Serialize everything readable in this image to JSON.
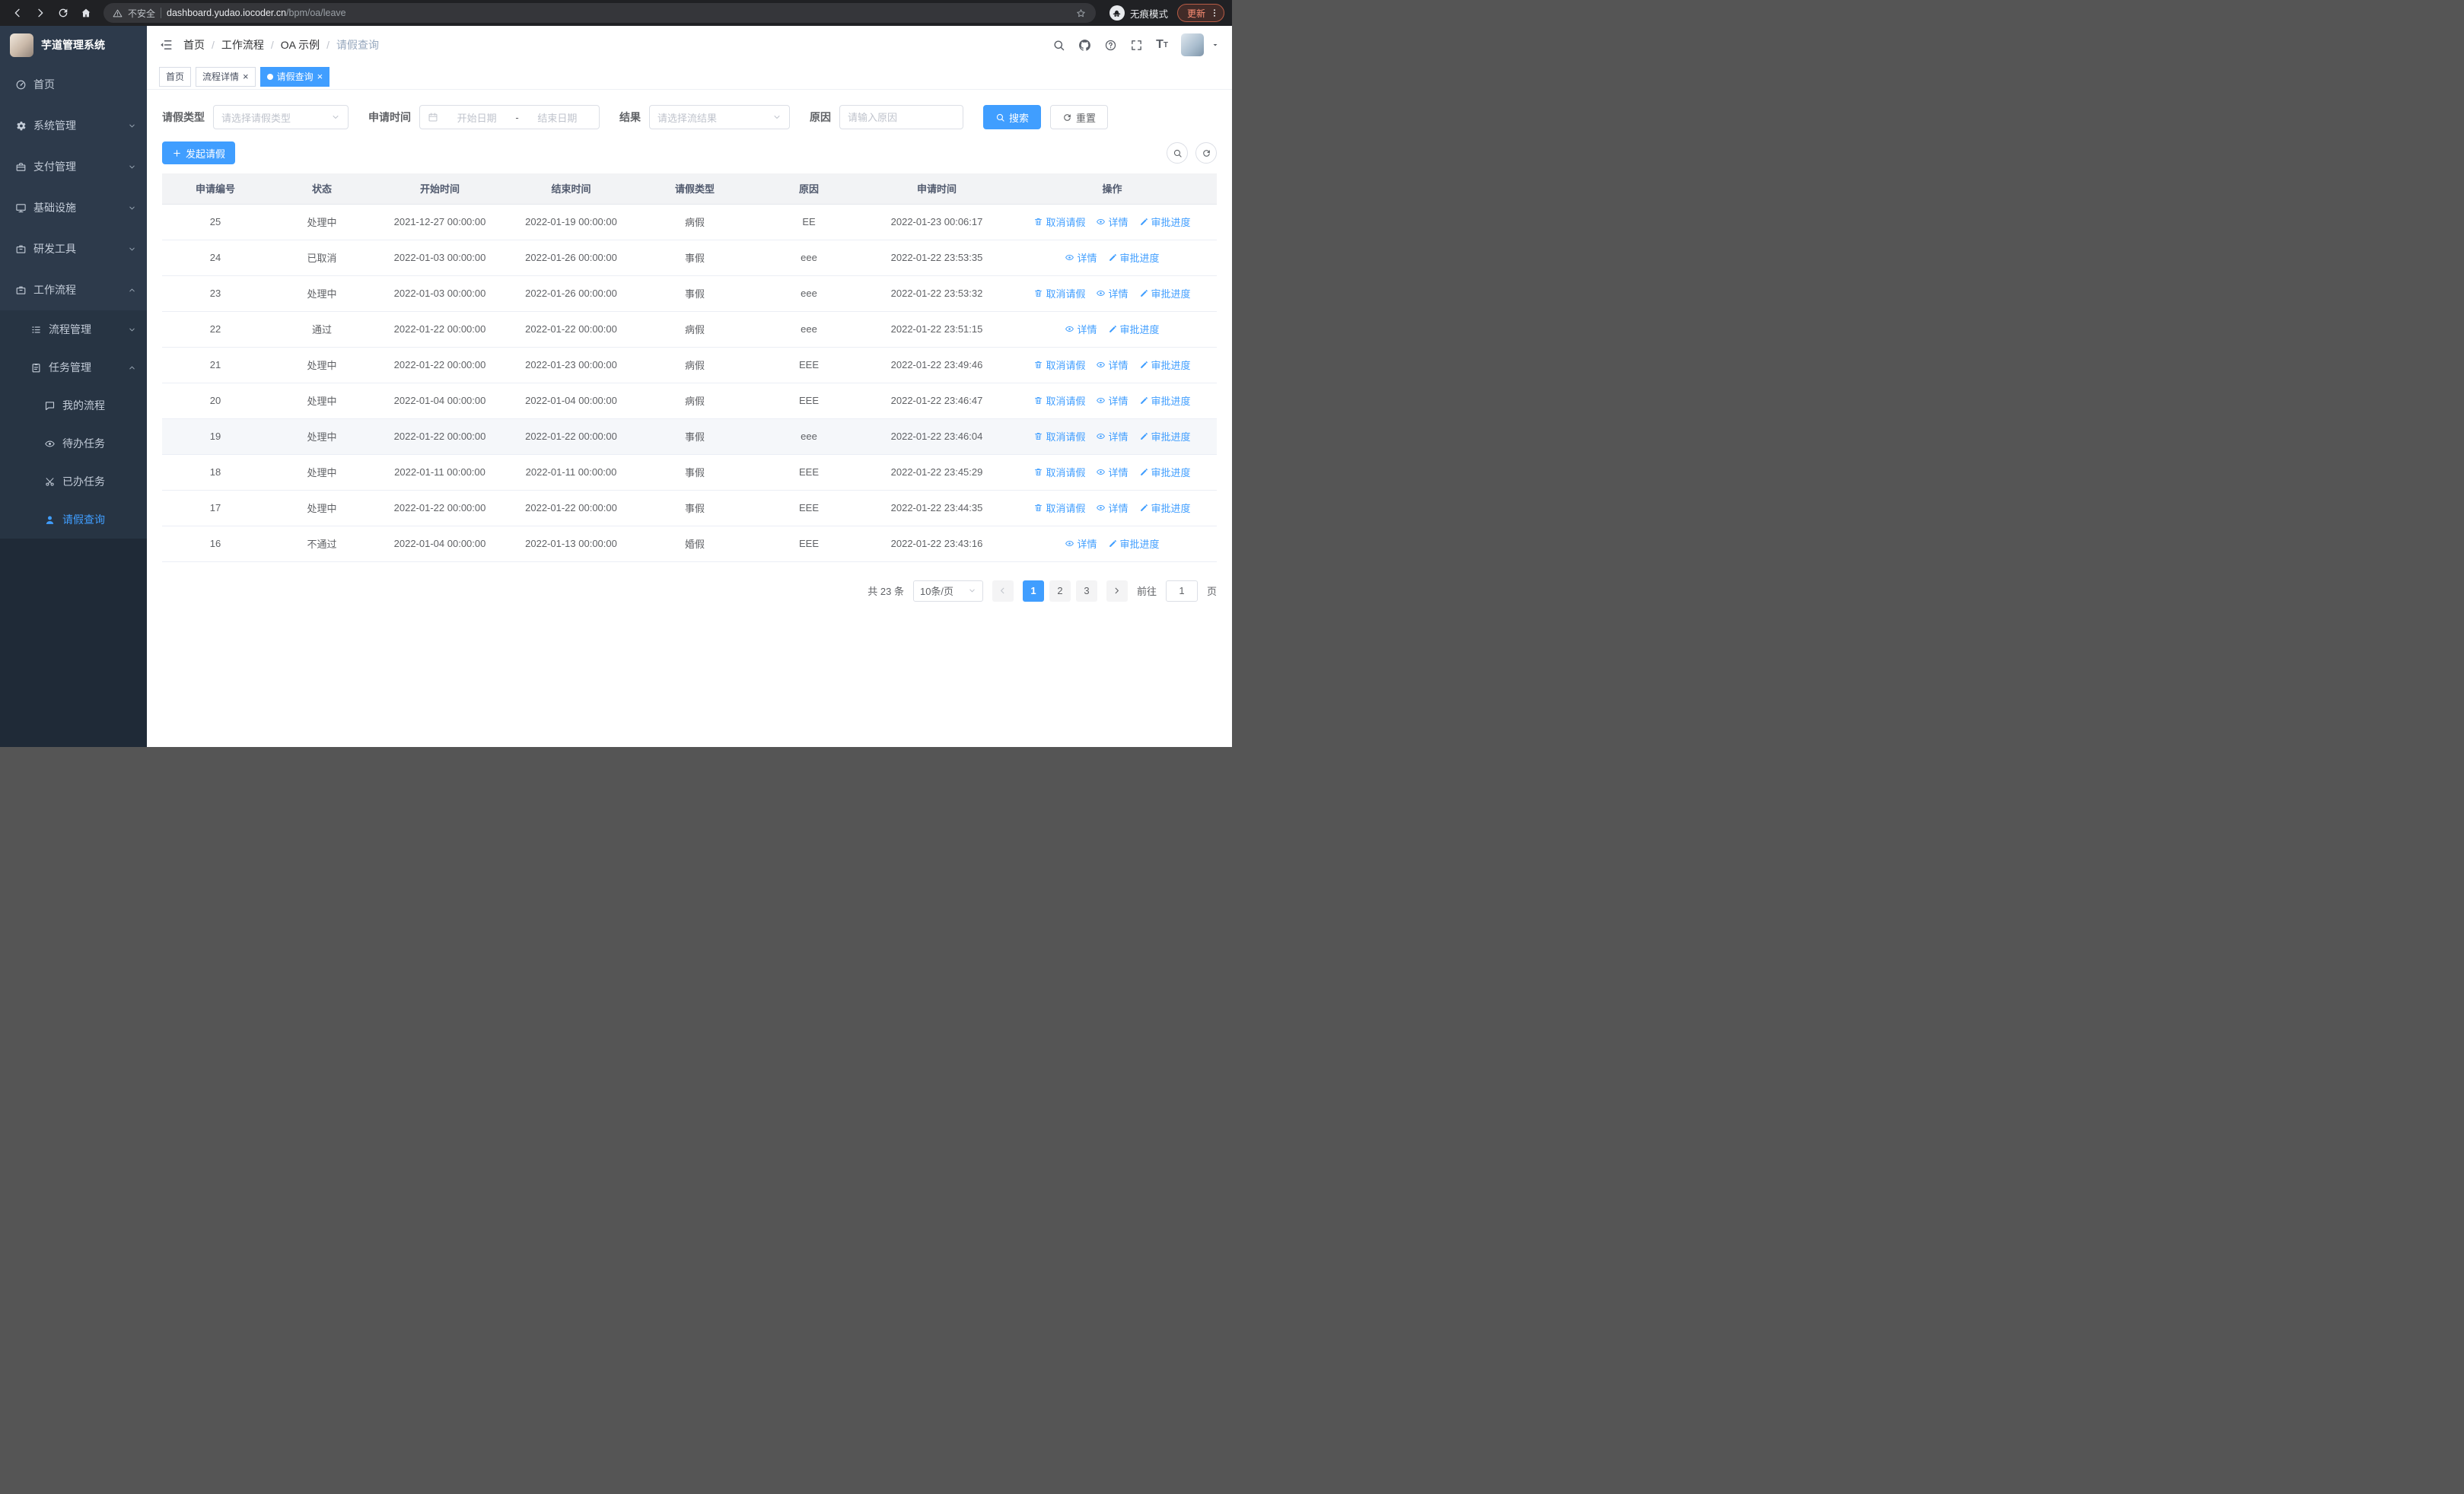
{
  "browser": {
    "security_label": "不安全",
    "url_host": "dashboard.yudao.iocoder.cn",
    "url_path": "/bpm/oa/leave",
    "incognito_label": "无痕模式",
    "update_label": "更新"
  },
  "sidebar": {
    "logo_title": "芋道管理系统",
    "home": "首页",
    "system": "系统管理",
    "payment": "支付管理",
    "infrastructure": "基础设施",
    "devtools": "研发工具",
    "workflow": "工作流程",
    "process_mgmt": "流程管理",
    "task_mgmt": "任务管理",
    "my_process": "我的流程",
    "todo_tasks": "待办任务",
    "done_tasks": "已办任务",
    "leave_query": "请假查询"
  },
  "breadcrumb": {
    "separator": "/",
    "items": [
      "首页",
      "工作流程",
      "OA 示例",
      "请假查询"
    ]
  },
  "tabs": {
    "home": "首页",
    "process_detail": "流程详情",
    "leave_query": "请假查询",
    "close_glyph": "×"
  },
  "filters": {
    "leave_type_label": "请假类型",
    "leave_type_placeholder": "请选择请假类型",
    "apply_time_label": "申请时间",
    "start_date_placeholder": "开始日期",
    "range_separator": "-",
    "end_date_placeholder": "结束日期",
    "result_label": "结果",
    "result_placeholder": "请选择流结果",
    "reason_label": "原因",
    "reason_placeholder": "请输入原因",
    "search_button": "搜索",
    "reset_button": "重置"
  },
  "toolbar": {
    "create_button": "发起请假"
  },
  "table": {
    "headers": [
      "申请编号",
      "状态",
      "开始时间",
      "结束时间",
      "请假类型",
      "原因",
      "申请时间",
      "操作"
    ],
    "action_labels": {
      "cancel": "取消请假",
      "detail": "详情",
      "progress": "审批进度"
    },
    "rows": [
      {
        "id": "25",
        "status": "处理中",
        "start": "2021-12-27 00:00:00",
        "end": "2022-01-19 00:00:00",
        "type": "病假",
        "reason": "EE",
        "apply": "2022-01-23 00:06:17",
        "actions": [
          "cancel",
          "detail",
          "progress"
        ],
        "highlighted": false
      },
      {
        "id": "24",
        "status": "已取消",
        "start": "2022-01-03 00:00:00",
        "end": "2022-01-26 00:00:00",
        "type": "事假",
        "reason": "eee",
        "apply": "2022-01-22 23:53:35",
        "actions": [
          "detail",
          "progress"
        ],
        "highlighted": false
      },
      {
        "id": "23",
        "status": "处理中",
        "start": "2022-01-03 00:00:00",
        "end": "2022-01-26 00:00:00",
        "type": "事假",
        "reason": "eee",
        "apply": "2022-01-22 23:53:32",
        "actions": [
          "cancel",
          "detail",
          "progress"
        ],
        "highlighted": false
      },
      {
        "id": "22",
        "status": "通过",
        "start": "2022-01-22 00:00:00",
        "end": "2022-01-22 00:00:00",
        "type": "病假",
        "reason": "eee",
        "apply": "2022-01-22 23:51:15",
        "actions": [
          "detail",
          "progress"
        ],
        "highlighted": false
      },
      {
        "id": "21",
        "status": "处理中",
        "start": "2022-01-22 00:00:00",
        "end": "2022-01-23 00:00:00",
        "type": "病假",
        "reason": "EEE",
        "apply": "2022-01-22 23:49:46",
        "actions": [
          "cancel",
          "detail",
          "progress"
        ],
        "highlighted": false
      },
      {
        "id": "20",
        "status": "处理中",
        "start": "2022-01-04 00:00:00",
        "end": "2022-01-04 00:00:00",
        "type": "病假",
        "reason": "EEE",
        "apply": "2022-01-22 23:46:47",
        "actions": [
          "cancel",
          "detail",
          "progress"
        ],
        "highlighted": false
      },
      {
        "id": "19",
        "status": "处理中",
        "start": "2022-01-22 00:00:00",
        "end": "2022-01-22 00:00:00",
        "type": "事假",
        "reason": "eee",
        "apply": "2022-01-22 23:46:04",
        "actions": [
          "cancel",
          "detail",
          "progress"
        ],
        "highlighted": true
      },
      {
        "id": "18",
        "status": "处理中",
        "start": "2022-01-11 00:00:00",
        "end": "2022-01-11 00:00:00",
        "type": "事假",
        "reason": "EEE",
        "apply": "2022-01-22 23:45:29",
        "actions": [
          "cancel",
          "detail",
          "progress"
        ],
        "highlighted": false
      },
      {
        "id": "17",
        "status": "处理中",
        "start": "2022-01-22 00:00:00",
        "end": "2022-01-22 00:00:00",
        "type": "事假",
        "reason": "EEE",
        "apply": "2022-01-22 23:44:35",
        "actions": [
          "cancel",
          "detail",
          "progress"
        ],
        "highlighted": false
      },
      {
        "id": "16",
        "status": "不通过",
        "start": "2022-01-04 00:00:00",
        "end": "2022-01-13 00:00:00",
        "type": "婚假",
        "reason": "EEE",
        "apply": "2022-01-22 23:43:16",
        "actions": [
          "detail",
          "progress"
        ],
        "highlighted": false
      }
    ]
  },
  "pagination": {
    "total_text": "共 23 条",
    "page_size": "10条/页",
    "pages": [
      "1",
      "2",
      "3"
    ],
    "active_page": "1",
    "goto_label": "前往",
    "goto_value": "1",
    "goto_suffix": "页"
  }
}
